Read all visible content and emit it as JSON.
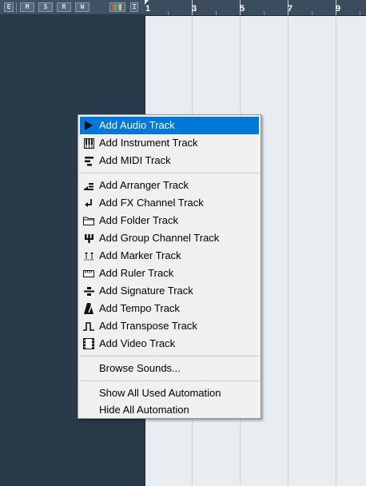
{
  "toolbar": {
    "buttons": [
      "E",
      "M",
      "S",
      "R",
      "W"
    ],
    "extra_icon": "color-swatch-icon",
    "extra_button": "I"
  },
  "ruler": {
    "marker_label": "1",
    "numbers": [
      "1",
      "3",
      "5",
      "7",
      "9"
    ]
  },
  "menu": {
    "items_group1": [
      {
        "label": "Add Audio Track",
        "icon": "play-arrow-icon",
        "highlighted": true
      },
      {
        "label": "Add Instrument Track",
        "icon": "piano-keys-icon"
      },
      {
        "label": "Add MIDI Track",
        "icon": "midi-bars-icon"
      }
    ],
    "items_group2": [
      {
        "label": "Add Arranger Track",
        "icon": "arranger-icon"
      },
      {
        "label": "Add FX Channel Track",
        "icon": "fx-channel-icon"
      },
      {
        "label": "Add Folder Track",
        "icon": "folder-icon"
      },
      {
        "label": "Add Group Channel Track",
        "icon": "group-channel-icon"
      },
      {
        "label": "Add Marker Track",
        "icon": "marker-icon"
      },
      {
        "label": "Add Ruler Track",
        "icon": "ruler-icon"
      },
      {
        "label": "Add Signature Track",
        "icon": "signature-icon"
      },
      {
        "label": "Add Tempo Track",
        "icon": "metronome-icon"
      },
      {
        "label": "Add Transpose Track",
        "icon": "transpose-icon"
      },
      {
        "label": "Add Video Track",
        "icon": "film-icon"
      }
    ],
    "browse_label": "Browse Sounds...",
    "automation": [
      {
        "label": "Show All Used Automation"
      },
      {
        "label": "Hide All Automation"
      }
    ]
  }
}
